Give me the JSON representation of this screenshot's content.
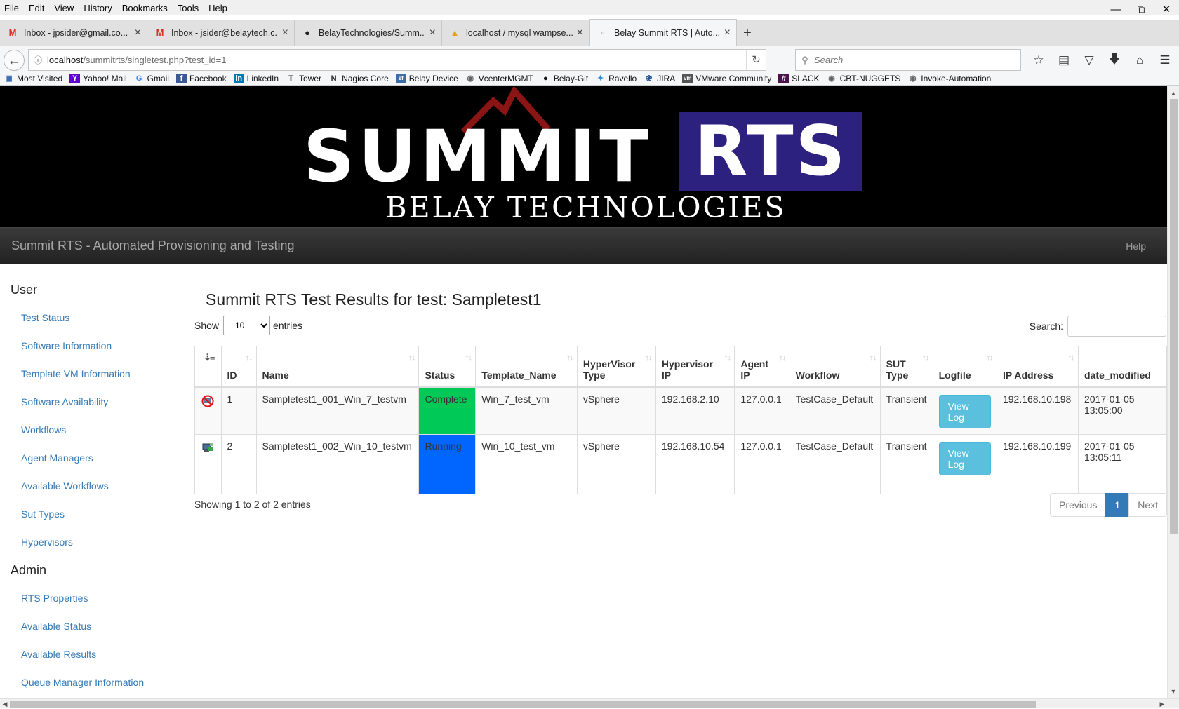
{
  "browser": {
    "menu": [
      "File",
      "Edit",
      "View",
      "History",
      "Bookmarks",
      "Tools",
      "Help"
    ],
    "tabs": [
      {
        "label": "Inbox - jpsider@gmail.co...",
        "icon": "gmail-icon",
        "active": false
      },
      {
        "label": "Inbox - jsider@belaytech.c...",
        "icon": "gmail-icon",
        "active": false
      },
      {
        "label": "BelayTechnologies/Summ...",
        "icon": "github-icon",
        "active": false
      },
      {
        "label": "localhost / mysql wampse...",
        "icon": "phpmyadmin-icon",
        "active": false
      },
      {
        "label": "Belay Summit RTS | Auto...",
        "icon": "page-icon",
        "active": true
      }
    ],
    "url_host": "localhost",
    "url_path": "/summitrts/singletest.php?test_id=1",
    "search_placeholder": "Search",
    "bookmarks": [
      {
        "label": "Most Visited",
        "icon": "most-visited-icon"
      },
      {
        "label": "Yahoo! Mail",
        "icon": "yahoo-icon"
      },
      {
        "label": "Gmail",
        "icon": "google-icon"
      },
      {
        "label": "Facebook",
        "icon": "facebook-icon"
      },
      {
        "label": "LinkedIn",
        "icon": "linkedin-icon"
      },
      {
        "label": "Tower",
        "icon": "tower-icon"
      },
      {
        "label": "Nagios Core",
        "icon": "nagios-icon"
      },
      {
        "label": "Belay Device",
        "icon": "belay-device-icon"
      },
      {
        "label": "VcenterMGMT",
        "icon": "vcenter-icon"
      },
      {
        "label": "Belay-Git",
        "icon": "github-icon"
      },
      {
        "label": "Ravello",
        "icon": "ravello-icon"
      },
      {
        "label": "JIRA",
        "icon": "jira-icon"
      },
      {
        "label": "VMware Community",
        "icon": "vmware-icon"
      },
      {
        "label": "SLACK",
        "icon": "slack-icon"
      },
      {
        "label": "CBT-NUGGETS",
        "icon": "cbt-icon"
      },
      {
        "label": "Invoke-Automation",
        "icon": "invoke-icon"
      }
    ]
  },
  "banner": {
    "logo_main": "SUMMIT",
    "logo_accent": "RTS",
    "logo_sub": "BELAY TECHNOLOGIES"
  },
  "appnav": {
    "brand": "Summit RTS - Automated Provisioning and Testing",
    "help": "Help"
  },
  "sidebar": {
    "user_heading": "User",
    "user_links": [
      "Test Status",
      "Software Information",
      "Template VM Information",
      "Software Availability",
      "Workflows",
      "Agent Managers",
      "Available Workflows",
      "Sut Types",
      "Hypervisors"
    ],
    "admin_heading": "Admin",
    "admin_links": [
      "RTS Properties",
      "Available Status",
      "Available Results",
      "Queue Manager Information"
    ]
  },
  "main": {
    "title": "Summit RTS Test Results for test: Sampletest1",
    "show_label": "Show",
    "entries_label": "entries",
    "page_length": "10",
    "search_label": "Search:",
    "columns": [
      "",
      "ID",
      "Name",
      "Status",
      "Template_Name",
      "HyperVisor Type",
      "Hypervisor IP",
      "Agent IP",
      "Workflow",
      "SUT Type",
      "Logfile",
      "IP Address",
      "date_modified"
    ],
    "rows": [
      {
        "icon": "no-network-icon",
        "id": "1",
        "name": "Sampletest1_001_Win_7_testvm",
        "status": "Complete",
        "template": "Win_7_test_vm",
        "hv_type": "vSphere",
        "hv_ip": "192.168.2.10",
        "agent_ip": "127.0.0.1",
        "workflow": "TestCase_Default",
        "sut_type": "Transient",
        "logfile": "View Log",
        "ip": "192.168.10.198",
        "date": "2017-01-05 13:05:00"
      },
      {
        "icon": "network-computer-icon",
        "id": "2",
        "name": "Sampletest1_002_Win_10_testvm",
        "status": "Running",
        "template": "Win_10_test_vm",
        "hv_type": "vSphere",
        "hv_ip": "192.168.10.54",
        "agent_ip": "127.0.0.1",
        "workflow": "TestCase_Default",
        "sut_type": "Transient",
        "logfile": "View Log",
        "ip": "192.168.10.199",
        "date": "2017-01-05 13:05:11"
      }
    ],
    "info": "Showing 1 to 2 of 2 entries",
    "pager": {
      "prev": "Previous",
      "current": "1",
      "next": "Next"
    }
  },
  "colors": {
    "complete": "#00c957",
    "running": "#0066ff",
    "rts_box": "#2d2180",
    "logo_peak": "#8b1414"
  }
}
